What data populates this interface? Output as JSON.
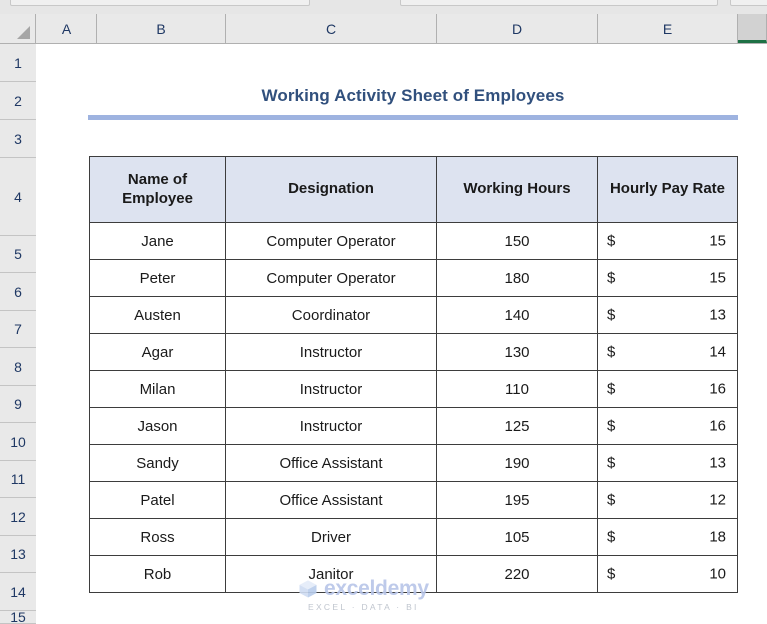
{
  "app": {
    "type": "spreadsheet",
    "column_headers": [
      "A",
      "B",
      "C",
      "D",
      "E"
    ],
    "selected_column": "F",
    "row_headers": [
      "1",
      "2",
      "3",
      "4",
      "5",
      "6",
      "7",
      "8",
      "9",
      "10",
      "11",
      "12",
      "13",
      "14",
      "15"
    ],
    "select_all_icon": "select-all-triangle-icon"
  },
  "sheet": {
    "title": "Working Activity Sheet of Employees",
    "title_color": "#31507d",
    "title_rule_color": "#9eb3e0"
  },
  "table": {
    "header_bg": "#dde3f0",
    "border_color": "#3d3d3d",
    "columns": [
      "Name of Employee",
      "Designation",
      "Working Hours",
      "Hourly Pay Rate"
    ],
    "rows": [
      {
        "name": "Jane",
        "designation": "Computer Operator",
        "hours": "150",
        "currency": "$",
        "rate": "15"
      },
      {
        "name": "Peter",
        "designation": "Computer Operator",
        "hours": "180",
        "currency": "$",
        "rate": "15"
      },
      {
        "name": "Austen",
        "designation": "Coordinator",
        "hours": "140",
        "currency": "$",
        "rate": "13"
      },
      {
        "name": "Agar",
        "designation": "Instructor",
        "hours": "130",
        "currency": "$",
        "rate": "14"
      },
      {
        "name": "Milan",
        "designation": "Instructor",
        "hours": "110",
        "currency": "$",
        "rate": "16"
      },
      {
        "name": "Jason",
        "designation": "Instructor",
        "hours": "125",
        "currency": "$",
        "rate": "16"
      },
      {
        "name": "Sandy",
        "designation": "Office Assistant",
        "hours": "190",
        "currency": "$",
        "rate": "13"
      },
      {
        "name": "Patel",
        "designation": "Office Assistant",
        "hours": "195",
        "currency": "$",
        "rate": "12"
      },
      {
        "name": "Ross",
        "designation": "Driver",
        "hours": "105",
        "currency": "$",
        "rate": "18"
      },
      {
        "name": "Rob",
        "designation": "Janitor",
        "hours": "220",
        "currency": "$",
        "rate": "10"
      }
    ]
  },
  "watermark": {
    "word": "exceldemy",
    "tagline": "EXCEL · DATA · BI",
    "color": "#b7c5e8"
  }
}
